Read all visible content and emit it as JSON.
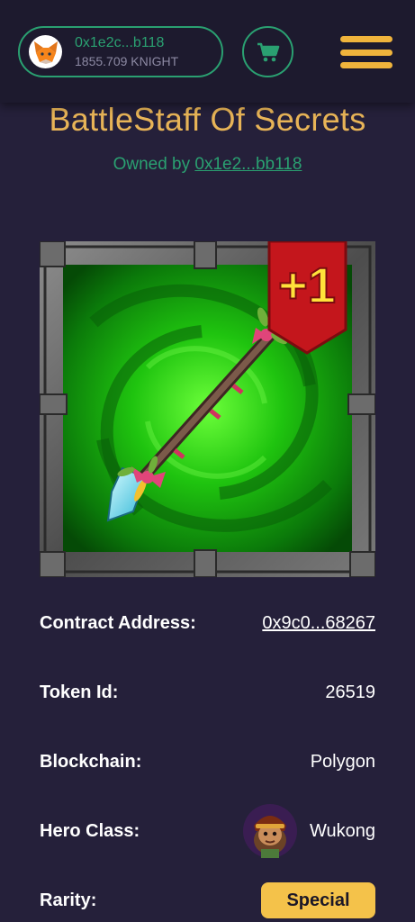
{
  "header": {
    "wallet_address": "0x1e2c...b118",
    "wallet_balance": "1855.709 KNIGHT",
    "icons": [
      "fox-icon",
      "cart-icon",
      "menu-icon"
    ]
  },
  "item": {
    "title": "BattleStaff Of Secrets",
    "owned_by_label": "Owned by",
    "owner_address": "0x1e2...bb118",
    "upgrade_badge": "+1"
  },
  "details": {
    "contract_label": "Contract Address:",
    "contract_value": "0x9c0...68267",
    "token_label": "Token Id:",
    "token_value": "26519",
    "blockchain_label": "Blockchain:",
    "blockchain_value": "Polygon",
    "hero_label": "Hero Class:",
    "hero_value": "Wukong",
    "rarity_label": "Rarity:",
    "rarity_value": "Special"
  },
  "colors": {
    "background": "#25203a",
    "header": "#1d1a2e",
    "accent_green": "#2aa071",
    "title_gold": "#e8b457",
    "menu_gold": "#f0b43c",
    "rarity_badge": "#f4c24a",
    "ribbon_red": "#c4161c"
  }
}
